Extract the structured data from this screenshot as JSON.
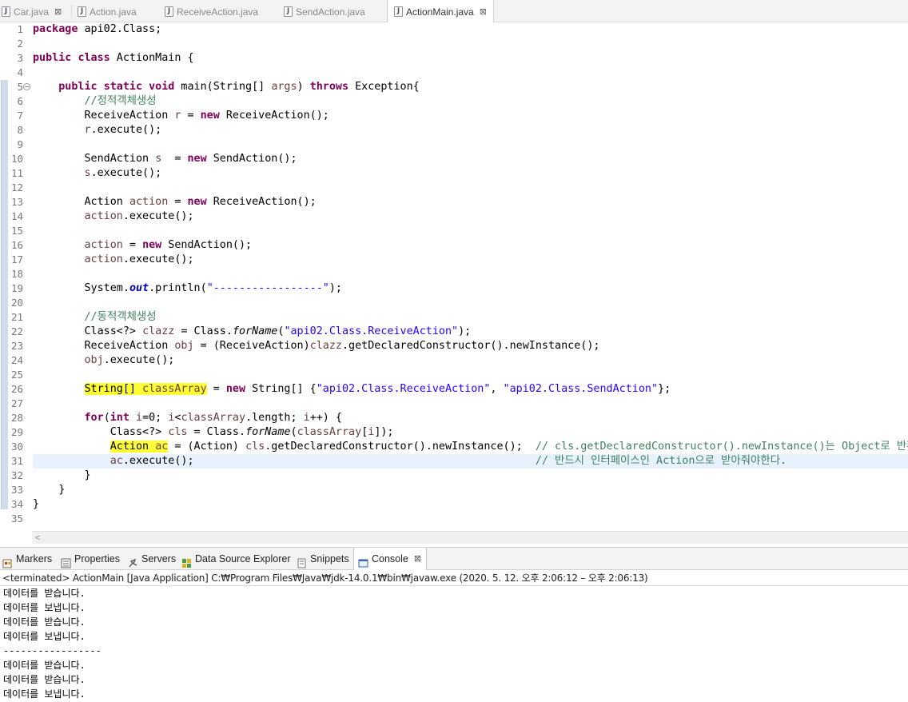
{
  "editor_tabs": [
    {
      "label": "Car.java",
      "active": false,
      "closable": true
    },
    {
      "label": "Action.java",
      "active": false,
      "closable": false
    },
    {
      "label": "ReceiveAction.java",
      "active": false,
      "closable": false
    },
    {
      "label": "SendAction.java",
      "active": false,
      "closable": false
    },
    {
      "label": "ActionMain.java",
      "active": true,
      "closable": true
    }
  ],
  "editor": {
    "line_numbers": [
      "1",
      "2",
      "3",
      "4",
      "5",
      "6",
      "7",
      "8",
      "9",
      "10",
      "11",
      "12",
      "13",
      "14",
      "15",
      "16",
      "17",
      "18",
      "19",
      "20",
      "21",
      "22",
      "23",
      "24",
      "25",
      "26",
      "27",
      "28",
      "29",
      "30",
      "31",
      "32",
      "33",
      "34",
      "35"
    ],
    "current_line": 31,
    "code": [
      "package api02.Class;",
      "",
      "public class ActionMain {",
      "",
      "    public static void main(String[] args) throws Exception{",
      "        //정적객체생성",
      "        ReceiveAction r = new ReceiveAction();",
      "        r.execute();",
      "",
      "        SendAction s  = new SendAction();",
      "        s.execute();",
      "",
      "        Action action = new ReceiveAction();",
      "        action.execute();",
      "",
      "        action = new SendAction();",
      "        action.execute();",
      "",
      "        System.out.println(\"-----------------\");",
      "",
      "        //동적객체생성",
      "        Class<?> clazz = Class.forName(\"api02.Class.ReceiveAction\");",
      "        ReceiveAction obj = (ReceiveAction)clazz.getDeclaredConstructor().newInstance();",
      "        obj.execute();",
      "",
      "        String[] classArray = new String[] {\"api02.Class.ReceiveAction\", \"api02.Class.SendAction\"};",
      "",
      "        for(int i=0; i<classArray.length; i++) {",
      "            Class<?> cls = Class.forName(classArray[i]);",
      "            Action ac = (Action) cls.getDeclaredConstructor().newInstance();  // cls.getDeclaredConstructor().newInstance()는 Object로 반환.",
      "            ac.execute();                                                     // 반드시 인터페이스인 Action으로 받아줘야한다.",
      "        }",
      "    }",
      "}",
      ""
    ]
  },
  "view_tabs": [
    {
      "label": "Markers",
      "icon": "markers-icon",
      "active": false
    },
    {
      "label": "Properties",
      "icon": "properties-icon",
      "active": false
    },
    {
      "label": "Servers",
      "icon": "servers-icon",
      "active": false
    },
    {
      "label": "Data Source Explorer",
      "icon": "data-source-explorer-icon",
      "active": false
    },
    {
      "label": "Snippets",
      "icon": "snippets-icon",
      "active": false
    },
    {
      "label": "Console",
      "icon": "console-icon",
      "active": true
    }
  ],
  "console": {
    "status": "<terminated> ActionMain [Java Application] C:₩Program Files₩Java₩jdk-14.0.1₩bin₩javaw.exe  (2020. 5. 12. 오후 2:06:12 – 오후 2:06:13)",
    "lines": [
      "데이터를 받습니다.",
      "데이터를 보냅니다.",
      "데이터를 받습니다.",
      "데이터를 보냅니다.",
      "-----------------",
      "데이터를 받습니다.",
      "데이터를 받습니다.",
      "데이터를 보냅니다."
    ]
  },
  "colors": {
    "keyword": "#7f0055",
    "string": "#2a00ff",
    "comment": "#3f7f5f",
    "static_field": "#0000c0",
    "local_variable": "#6a3e3e",
    "occurrence_highlight": "#ffff33",
    "current_line": "#e8f2fe"
  }
}
